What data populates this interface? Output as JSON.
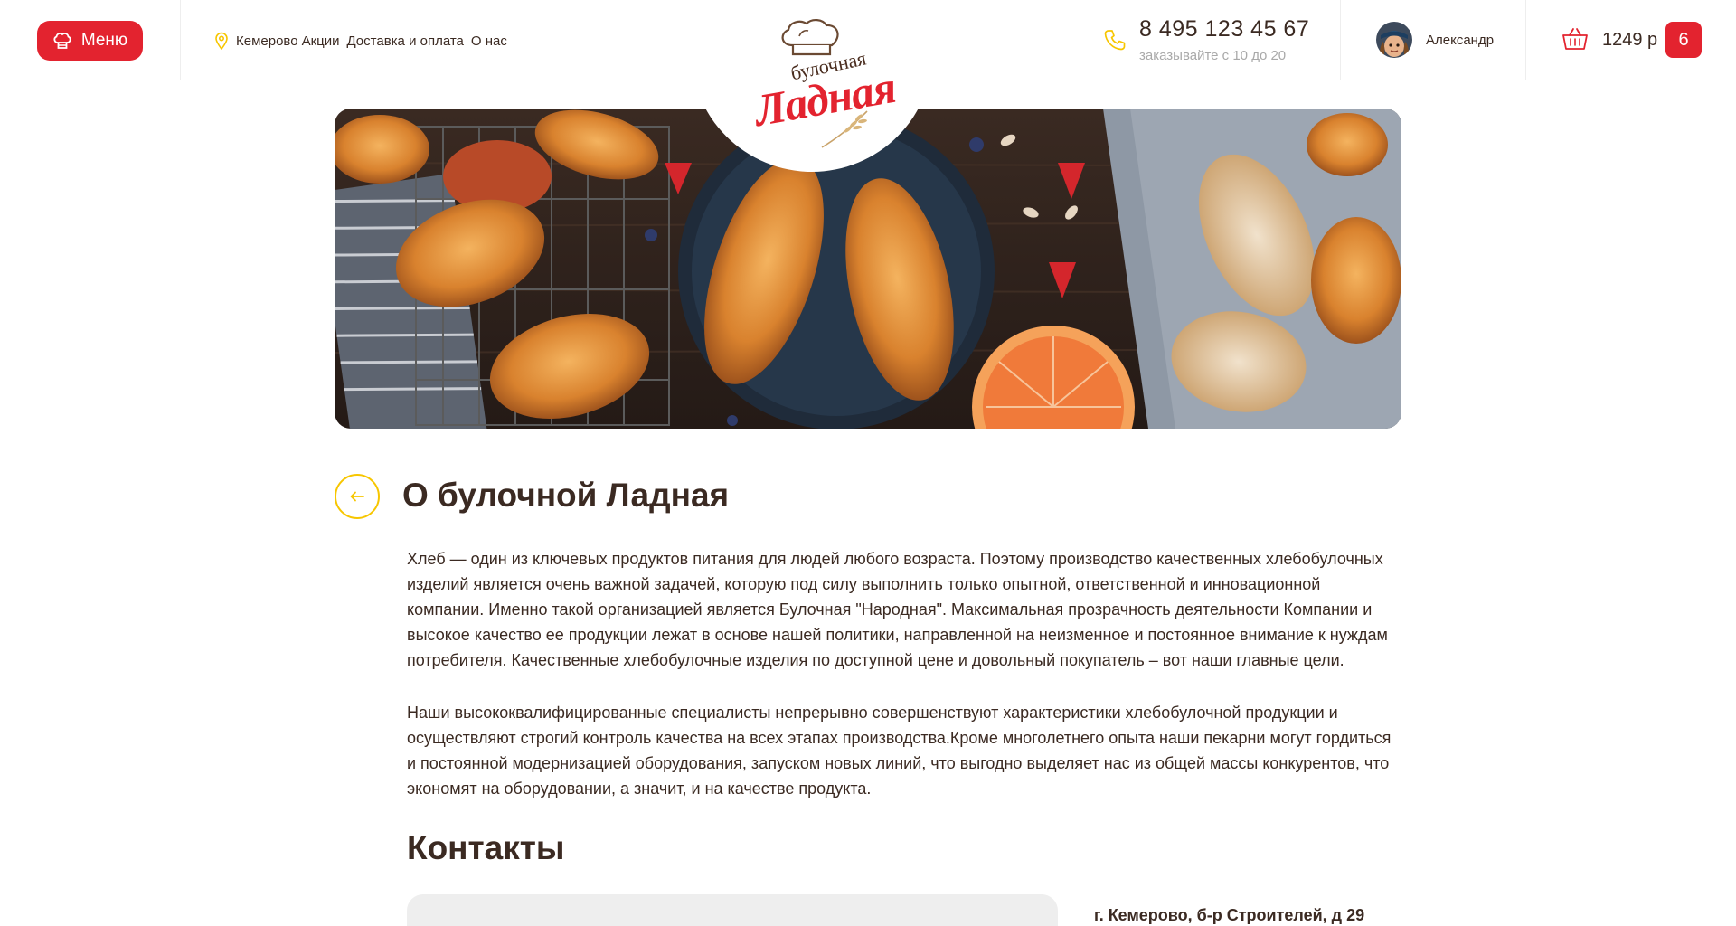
{
  "colors": {
    "accent": "#e3232f",
    "yellow": "#f7c600",
    "text": "#3b2a22",
    "muted": "#a9a9a9"
  },
  "header": {
    "menu_label": "Меню",
    "city": "Кемерово",
    "nav": [
      "Акции",
      "Доставка и оплата",
      "О нас"
    ],
    "logo_sub": "булочная",
    "logo_main": "Ладная",
    "phone": "8 495 123 45 67",
    "phone_note": "заказывайте с 10 до 20",
    "user_name": "Александр",
    "cart_sum": "1249 р",
    "cart_count": "6"
  },
  "icons": {
    "menu": "chef-hat-icon",
    "location": "location-pin-icon",
    "phone": "phone-icon",
    "cart": "basket-icon",
    "back": "arrow-left-icon"
  },
  "main": {
    "title": "О булочной Ладная",
    "paragraphs": [
      "Хлеб — один из ключевых продуктов питания для людей любого возраста. Поэтому производство качественных хлебобулочных изделий является очень важной задачей, которую под силу выполнить только опытной, ответственной и инновационной компании. Именно такой организацией является Булочная \"Народная\". Максимальная прозрачность деятельности Компании и высокое качество ее продукции лежат в основе нашей политики, направленной на неизменное и постоянное внимание к нуждам потребителя. Качественные хлебобулочные изделия по доступной цене и довольный покупатель – вот наши главные цели.",
      "Наши высококвалифицированные специалисты непрерывно совершенствуют характеристики хлебобулочной продукции и осуществляют строгий контроль качества на всех этапах производства.Кроме многолетнего опыта наши пекарни могут гордиться и постоянной модернизацией оборудования, запуском новых линий, что выгодно выделяет нас из общей массы конкурентов, что экономят на оборудовании, а значит, и на качестве продукта."
    ],
    "contacts_title": "Контакты",
    "address": "г. Кемерово, б-р Строителей, д 29"
  }
}
